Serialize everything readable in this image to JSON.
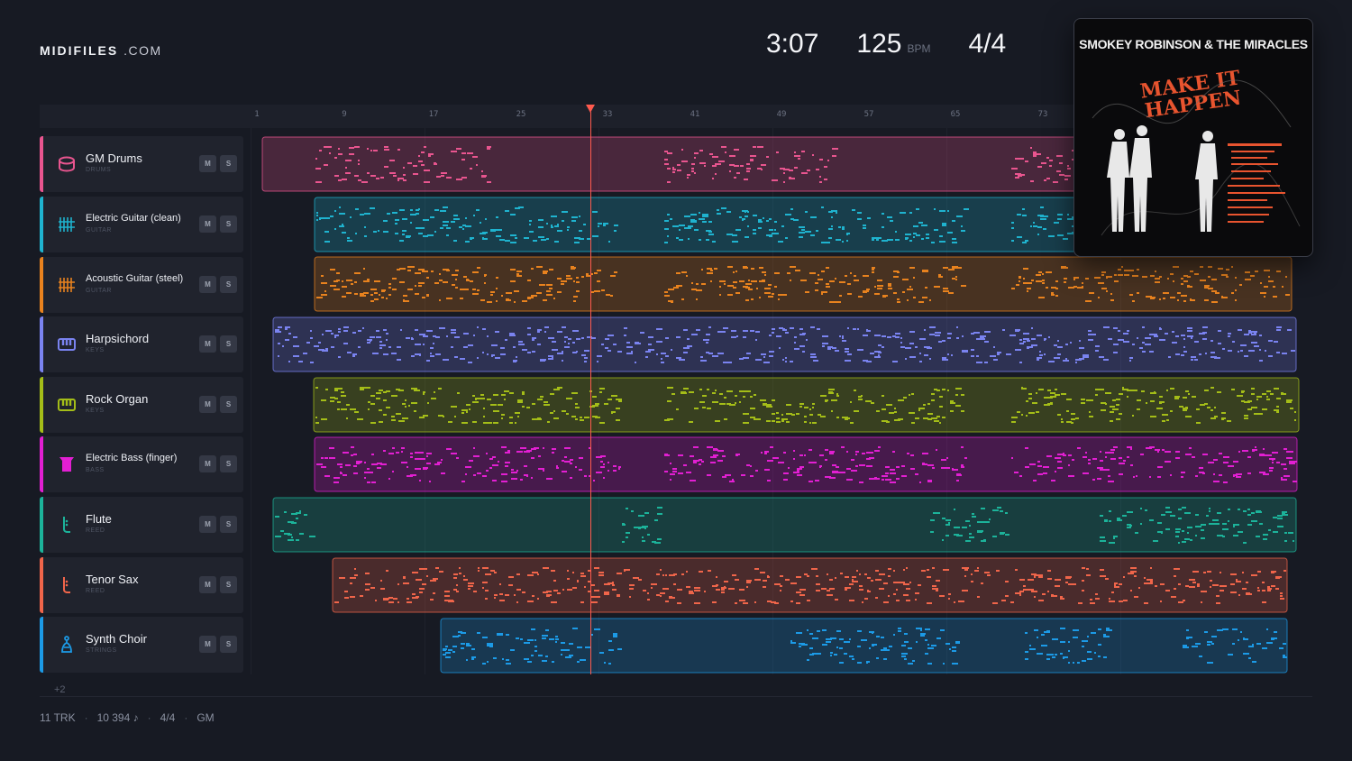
{
  "logo": {
    "brand": "MIDIFILES",
    "tld": ".COM"
  },
  "header": {
    "time": "3:07",
    "tempo": "125",
    "tempo_unit": "BPM",
    "time_signature": "4/4"
  },
  "ruler": {
    "ticks": [
      "1",
      "9",
      "17",
      "25",
      "33",
      "41",
      "49",
      "57",
      "65",
      "73"
    ]
  },
  "colors": {
    "background": "#171a23",
    "playhead": "#ff5a4e"
  },
  "tracks": [
    {
      "name": "GM Drums",
      "category": "DRUMS",
      "color": "#e9558f",
      "icon": "drum-icon",
      "mute": "M",
      "solo": "S"
    },
    {
      "name": "Electric Guitar (clean)",
      "category": "GUITAR",
      "color": "#1fb3cf",
      "icon": "guitar-icon",
      "mute": "M",
      "solo": "S"
    },
    {
      "name": "Acoustic Guitar (steel)",
      "category": "GUITAR",
      "color": "#e8821e",
      "icon": "guitar-icon",
      "mute": "M",
      "solo": "S"
    },
    {
      "name": "Harpsichord",
      "category": "KEYS",
      "color": "#7a83f0",
      "icon": "keyboard-icon",
      "mute": "M",
      "solo": "S"
    },
    {
      "name": "Rock Organ",
      "category": "KEYS",
      "color": "#a4bd18",
      "icon": "keyboard-icon",
      "mute": "M",
      "solo": "S"
    },
    {
      "name": "Electric Bass (finger)",
      "category": "BASS",
      "color": "#e21fd2",
      "icon": "bass-icon",
      "mute": "M",
      "solo": "S"
    },
    {
      "name": "Flute",
      "category": "REED",
      "color": "#1cb39a",
      "icon": "reed-icon",
      "mute": "M",
      "solo": "S"
    },
    {
      "name": "Tenor Sax",
      "category": "REED",
      "color": "#f0654a",
      "icon": "reed-icon",
      "mute": "M",
      "solo": "S"
    },
    {
      "name": "Synth Choir",
      "category": "STRINGS",
      "color": "#1c9ae6",
      "icon": "strings-icon",
      "mute": "M",
      "solo": "S"
    }
  ],
  "album": {
    "artist": "SMOKEY ROBINSON & THE MIRACLES",
    "title": "MAKE IT HAPPEN"
  },
  "more_tracks": "+2",
  "footer": {
    "tracks": "11 TRK",
    "notes": "10 394 ♪",
    "time_signature": "4/4",
    "standard": "GM"
  }
}
